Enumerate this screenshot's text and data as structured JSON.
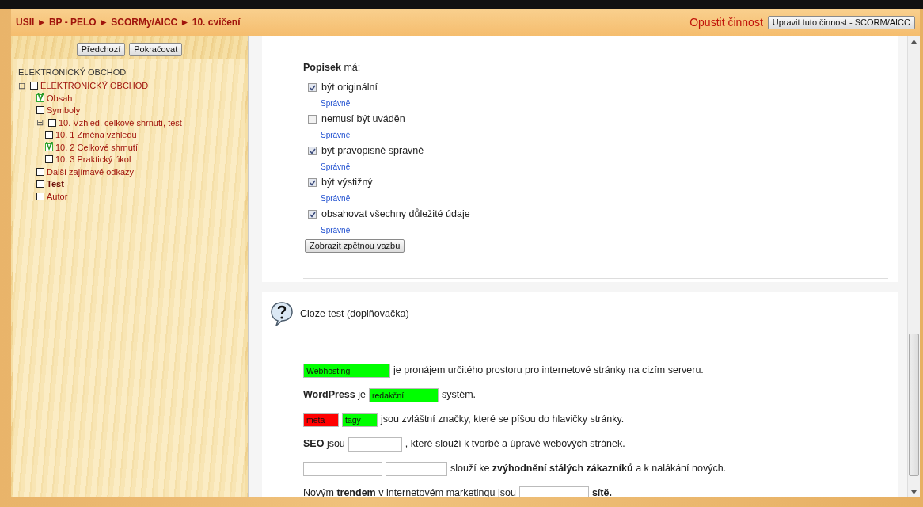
{
  "breadcrumb": {
    "items": [
      "USII",
      "BP - PELO",
      "SCORMy/AICC",
      "10. cvičení"
    ],
    "separator": "►"
  },
  "header_actions": {
    "link": "Opustit činnost",
    "button": "Upravit tuto činnost - SCORM/AICC"
  },
  "nav_buttons": [
    "Předchozí",
    "Pokračovat"
  ],
  "toc": {
    "title": "ELEKTRONICKÝ OBCHOD",
    "items": [
      {
        "label": "ELEKTRONICKÝ OBCHOD",
        "toggle": "⊟",
        "expanded": true,
        "completed": false,
        "current": false,
        "children": [
          {
            "label": "Obsah",
            "completed": true,
            "current": false
          },
          {
            "label": "Symboly",
            "completed": false,
            "current": false
          },
          {
            "label": "10. Vzhled, celkové shrnutí, test",
            "toggle": "⊟",
            "expanded": true,
            "completed": false,
            "current": false,
            "children": [
              {
                "label": "10. 1 Změna vzhledu",
                "completed": false,
                "current": false
              },
              {
                "label": "10. 2 Celkové shrnutí",
                "completed": true,
                "current": false
              },
              {
                "label": "10. 3 Praktický úkol",
                "completed": false,
                "current": false
              }
            ]
          },
          {
            "label": "Další zajímavé odkazy",
            "completed": false,
            "current": false
          },
          {
            "label": "Test",
            "completed": false,
            "current": true
          },
          {
            "label": "Autor",
            "completed": false,
            "current": false
          }
        ]
      }
    ]
  },
  "question1": {
    "prompt": "**Popisek** má:",
    "options": [
      {
        "label": "být originální",
        "checked": true,
        "feedback": "Správně"
      },
      {
        "label": "nemusí být uváděn",
        "checked": false,
        "feedback": "Správně"
      },
      {
        "label": "být pravopisně správně",
        "checked": true,
        "feedback": "Správně"
      },
      {
        "label": "být výstižný",
        "checked": true,
        "feedback": "Správně"
      },
      {
        "label": "obsahovat všechny důležité údaje",
        "checked": true,
        "feedback": "Správně"
      }
    ],
    "feedback_button": "Zobrazit zpětnou vazbu"
  },
  "question2": {
    "title": "Cloze test (doplňovačka)",
    "sentences": [
      [
        {
          "kind": "field",
          "value": "Webhosting",
          "graded": true,
          "correct": true
        },
        {
          "kind": "text",
          "text": "je pronájem určitého prostoru pro internetové stránky na cizím serveru."
        }
      ],
      [
        {
          "kind": "text",
          "text": "**WordPress** je"
        },
        {
          "kind": "field",
          "value": "redakční",
          "graded": true,
          "correct": true
        },
        {
          "kind": "text",
          "text": "systém."
        }
      ],
      [
        {
          "kind": "field",
          "value": "meta",
          "graded": true,
          "correct": false
        },
        {
          "kind": "field",
          "value": "tagy",
          "graded": true,
          "correct": true
        },
        {
          "kind": "text",
          "text": "jsou zvláštní značky, které se píšou do hlavičky stránky."
        }
      ],
      [
        {
          "kind": "text",
          "text": "**SEO** jsou"
        },
        {
          "kind": "field",
          "graded": false
        },
        {
          "kind": "text",
          "text": ", které slouží k tvorbě a úpravě webových stránek."
        }
      ],
      [
        {
          "kind": "field",
          "graded": false
        },
        {
          "kind": "field",
          "graded": false
        },
        {
          "kind": "text",
          "text": "slouží ke **zvýhodnění stálých zákazníků** a k nalákání nových."
        }
      ],
      [
        {
          "kind": "text",
          "text": "Novým **trendem** v internetovém marketingu jsou"
        },
        {
          "kind": "field",
          "graded": false
        },
        {
          "kind": "text",
          "text": "**sítě.**"
        }
      ]
    ]
  }
}
